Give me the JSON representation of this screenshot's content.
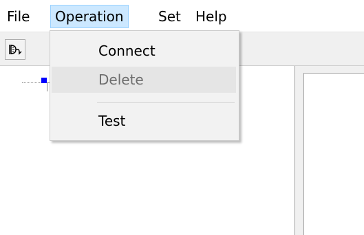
{
  "menubar": {
    "items": [
      {
        "label": "File"
      },
      {
        "label": "Operation"
      },
      {
        "label": "Set"
      },
      {
        "label": "Help"
      }
    ]
  },
  "toolbar": {
    "connect_icon": "plug-connect-icon"
  },
  "dropdown": {
    "items": [
      {
        "label": "Connect",
        "enabled": true
      },
      {
        "label": "Delete",
        "enabled": false
      },
      {
        "label": "Test",
        "enabled": true
      }
    ]
  },
  "colors": {
    "menu_highlight": "#cce8ff",
    "menu_highlight_border": "#99d1ff",
    "tree_node": "#0000ff",
    "disabled_text": "#6d6d6d"
  }
}
